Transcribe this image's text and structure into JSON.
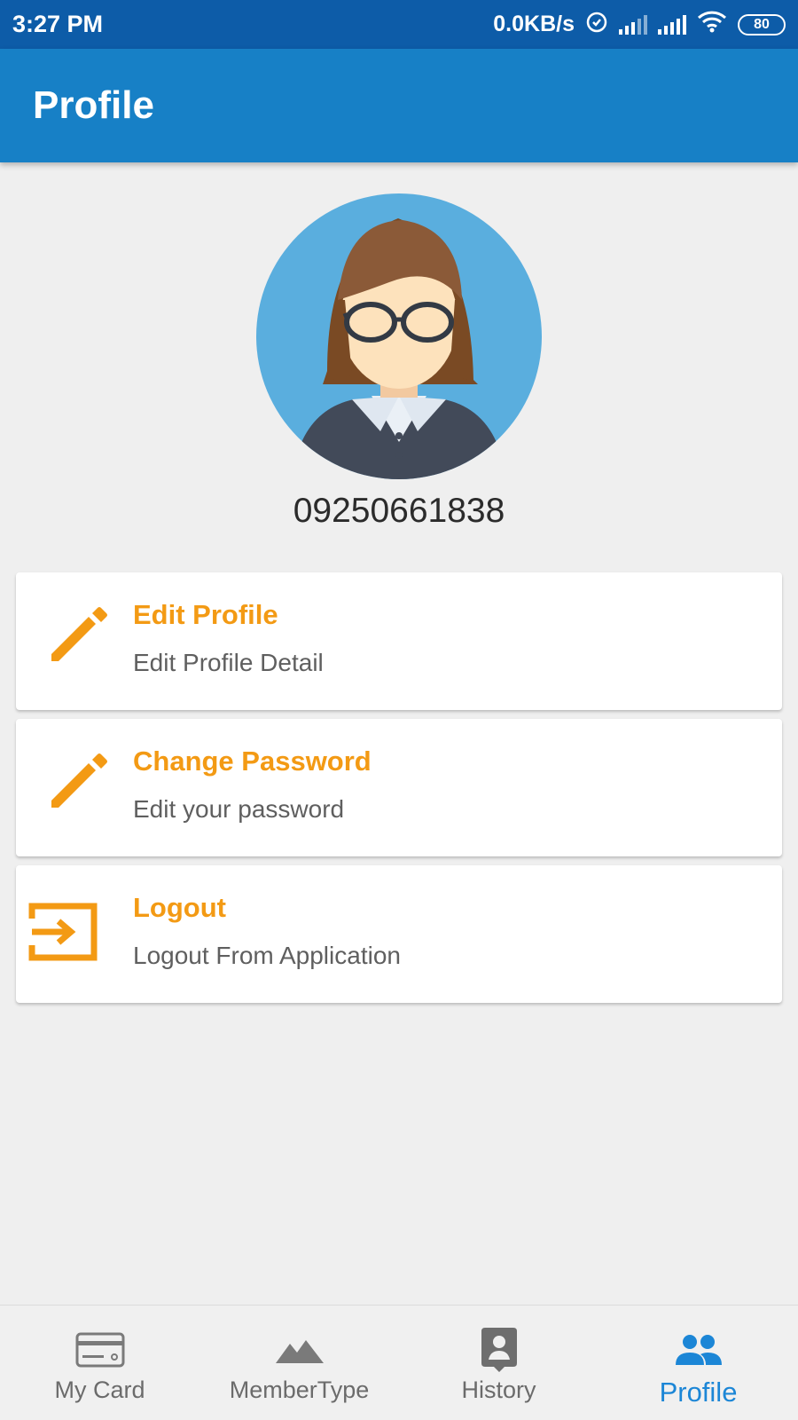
{
  "status_bar": {
    "time": "3:27 PM",
    "network_speed": "0.0KB/s",
    "battery": "80"
  },
  "app_bar": {
    "title": "Profile"
  },
  "profile": {
    "phone": "09250661838"
  },
  "menu": [
    {
      "title": "Edit Profile",
      "subtitle": "Edit Profile Detail",
      "icon": "pencil-icon"
    },
    {
      "title": "Change Password",
      "subtitle": "Edit your password",
      "icon": "pencil-icon"
    },
    {
      "title": "Logout",
      "subtitle": "Logout From Application",
      "icon": "logout-icon"
    }
  ],
  "bottom_nav": {
    "items": [
      {
        "label": "My Card",
        "icon": "card-icon",
        "active": false
      },
      {
        "label": "MemberType",
        "icon": "mountain-icon",
        "active": false
      },
      {
        "label": "History",
        "icon": "contact-badge-icon",
        "active": false
      },
      {
        "label": "Profile",
        "icon": "people-icon",
        "active": true
      }
    ]
  },
  "colors": {
    "status_bar": "#0d5ca8",
    "app_bar": "#1780c6",
    "accent_orange": "#f39a14",
    "nav_active": "#1c86d6",
    "nav_inactive": "#6b6b6b"
  }
}
